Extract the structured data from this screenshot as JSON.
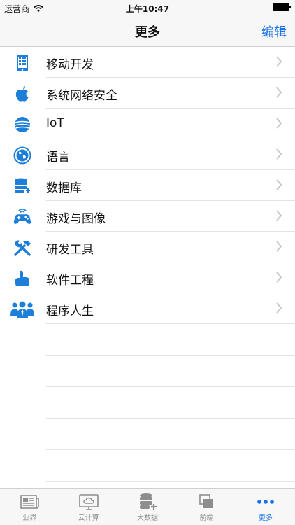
{
  "status": {
    "carrier": "运营商",
    "time": "上午10:47"
  },
  "nav": {
    "title": "更多",
    "edit_label": "编辑"
  },
  "list": {
    "items": [
      {
        "label": "移动开发",
        "icon": "mobile-icon"
      },
      {
        "label": "系统网络安全",
        "icon": "apple-icon"
      },
      {
        "label": "IoT",
        "icon": "iot-globe-icon"
      },
      {
        "label": "语言",
        "icon": "globe-icon"
      },
      {
        "label": "数据库",
        "icon": "database-icon"
      },
      {
        "label": "游戏与图像",
        "icon": "gamepad-icon"
      },
      {
        "label": "研发工具",
        "icon": "tools-icon"
      },
      {
        "label": "软件工程",
        "icon": "software-icon"
      },
      {
        "label": "程序人生",
        "icon": "people-icon"
      }
    ]
  },
  "tabs": [
    {
      "label": "业界",
      "icon": "newspaper-icon"
    },
    {
      "label": "云计算",
      "icon": "cloud-monitor-icon"
    },
    {
      "label": "大数据",
      "icon": "database-add-icon"
    },
    {
      "label": "前端",
      "icon": "layers-icon"
    },
    {
      "label": "更多",
      "icon": "more-dots-icon"
    }
  ],
  "colors": {
    "accent": "#1a73e8",
    "icon_blue": "#1e7fd8",
    "tab_inactive": "#8e8e8e"
  }
}
